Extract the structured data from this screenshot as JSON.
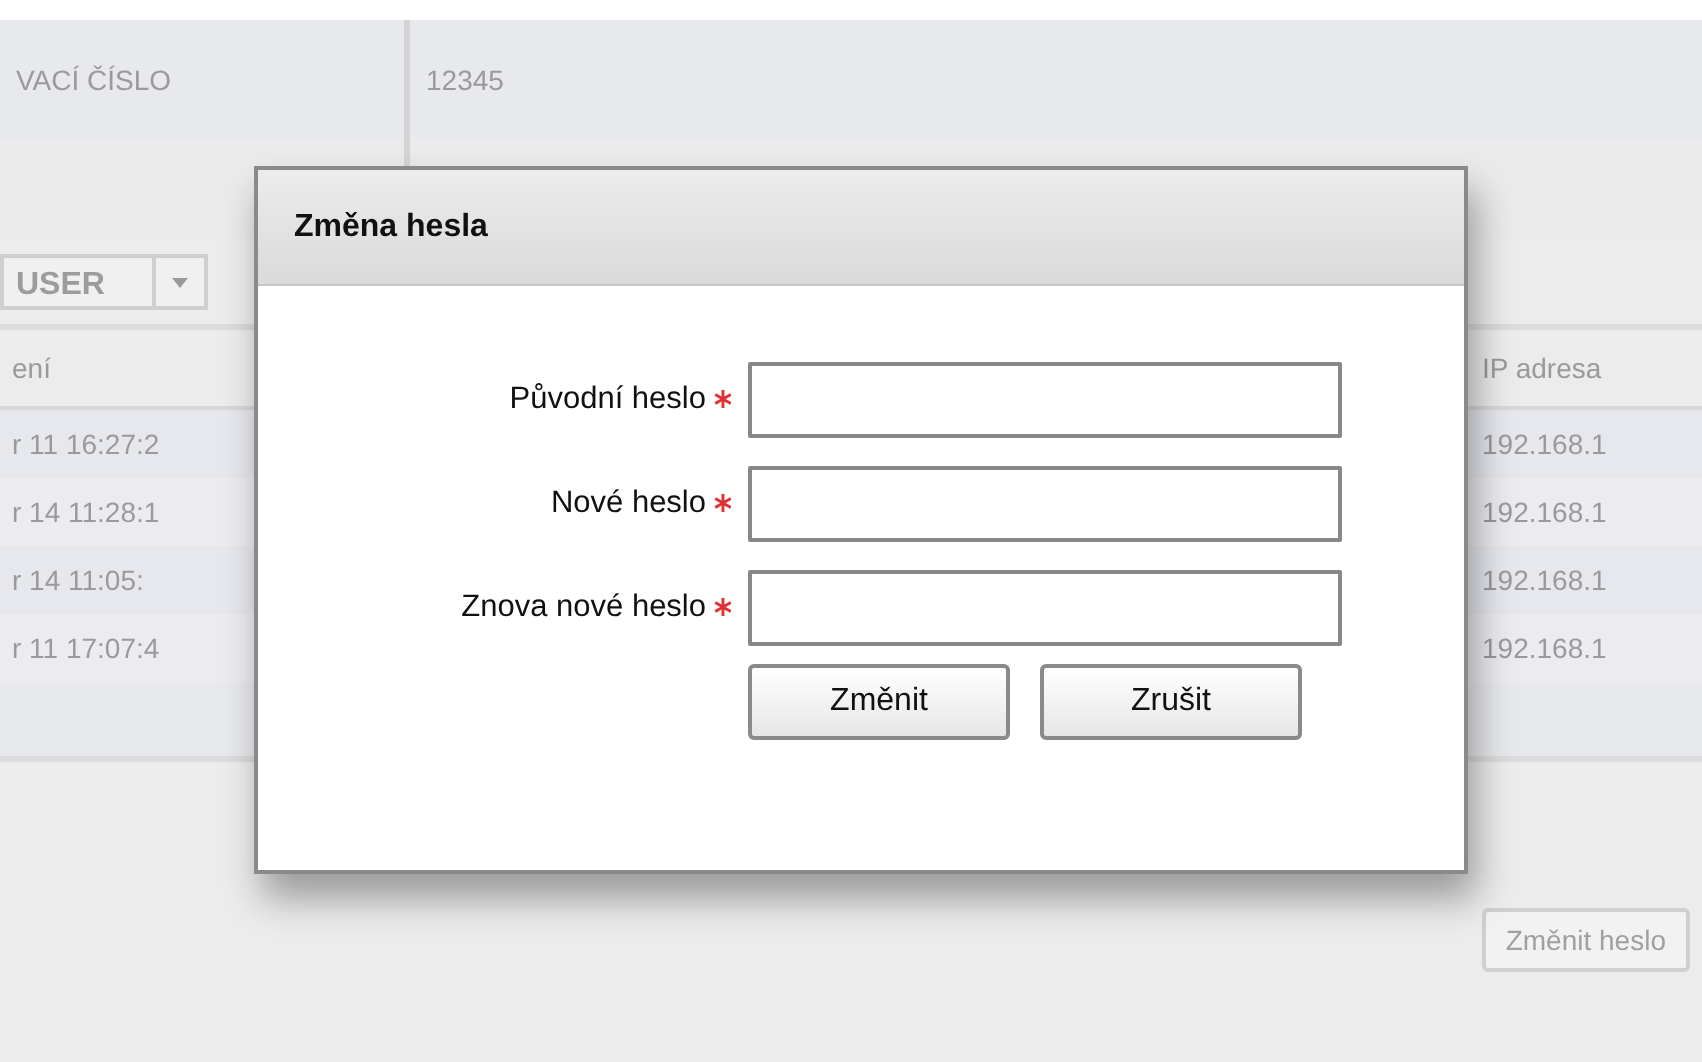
{
  "background": {
    "info_rows": [
      {
        "label": "VACÍ ČÍSLO",
        "value": "12345"
      }
    ],
    "role_select": {
      "value": "USER"
    },
    "table": {
      "columns": [
        "ení",
        "IP adresa"
      ],
      "rows": [
        [
          "r 11 16:27:2",
          "192.168.1"
        ],
        [
          "r 14 11:28:1",
          "192.168.1"
        ],
        [
          "r 14 11:05:",
          "192.168.1"
        ],
        [
          "r 11 17:07:4",
          "192.168.1"
        ]
      ]
    },
    "footer_buttons": [
      "Změnit heslo"
    ]
  },
  "dialog": {
    "title": "Změna hesla",
    "fields": [
      {
        "label": "Původní heslo",
        "required": true
      },
      {
        "label": "Nové heslo",
        "required": true
      },
      {
        "label": "Znova nové heslo",
        "required": true
      }
    ],
    "buttons": [
      "Změnit",
      "Zrušit"
    ]
  }
}
